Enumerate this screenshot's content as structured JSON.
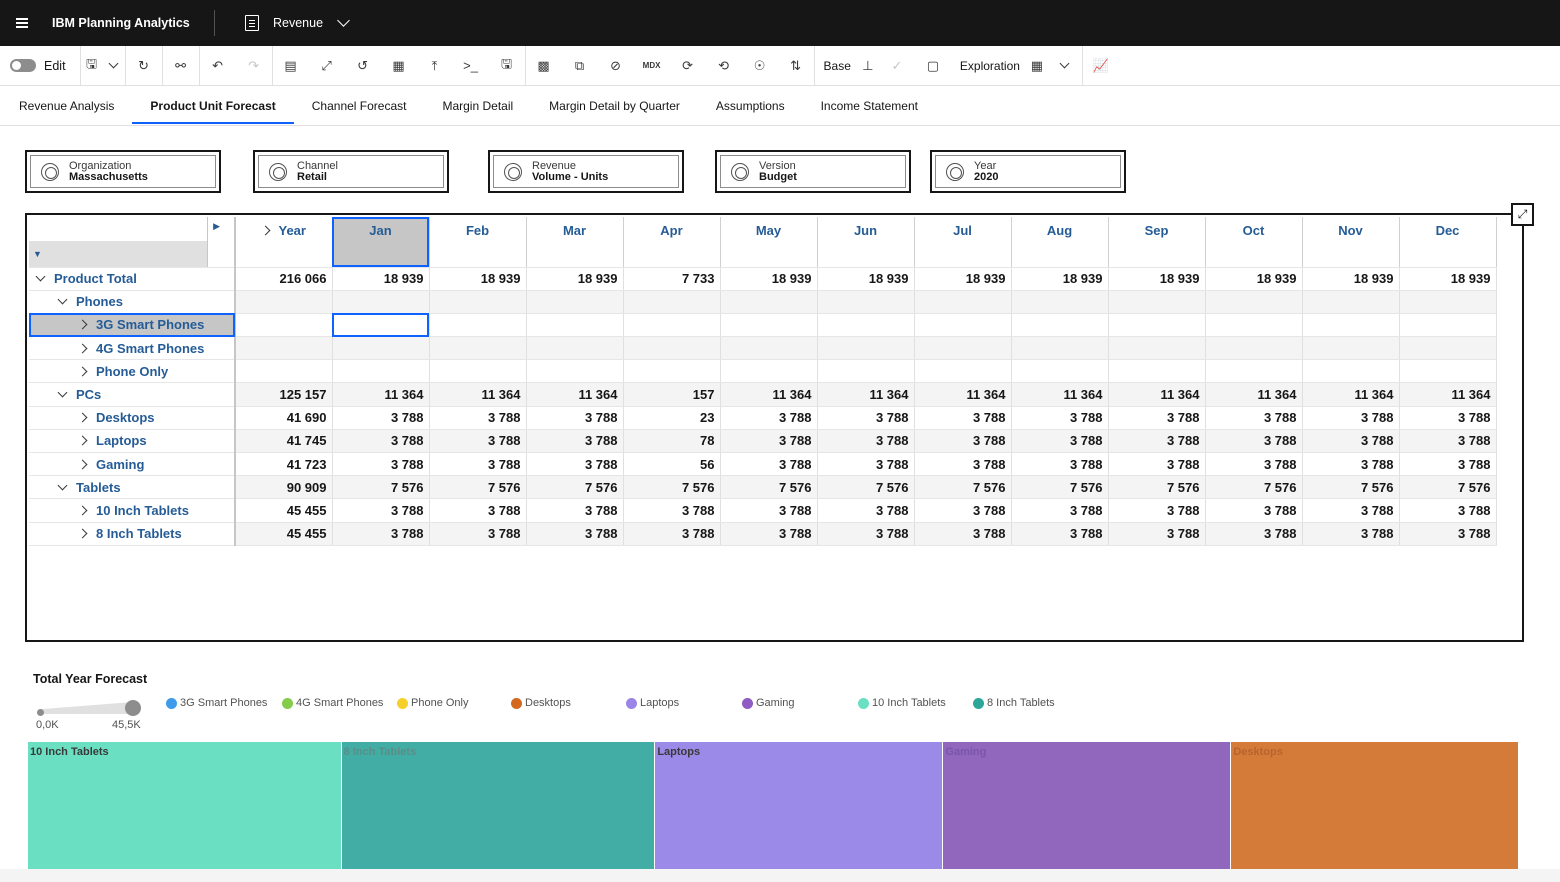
{
  "header": {
    "app_title": "IBM Planning Analytics",
    "book_title": "Revenue"
  },
  "toolbar": {
    "edit_label": "Edit",
    "base_label": "Base",
    "exploration_label": "Exploration",
    "mdx_label": "MDX"
  },
  "tabs": [
    {
      "label": "Revenue Analysis",
      "active": false
    },
    {
      "label": "Product Unit Forecast",
      "active": true
    },
    {
      "label": "Channel Forecast",
      "active": false
    },
    {
      "label": "Margin Detail",
      "active": false
    },
    {
      "label": "Margin Detail by Quarter",
      "active": false
    },
    {
      "label": "Assumptions",
      "active": false
    },
    {
      "label": "Income Statement",
      "active": false
    }
  ],
  "selectors": [
    {
      "dimension": "Organization",
      "member": "Massachusetts"
    },
    {
      "dimension": "Channel",
      "member": "Retail"
    },
    {
      "dimension": "Revenue",
      "member": "Volume - Units"
    },
    {
      "dimension": "Version",
      "member": "Budget"
    },
    {
      "dimension": "Year",
      "member": "2020"
    }
  ],
  "grid": {
    "columns": [
      "Year",
      "Jan",
      "Feb",
      "Mar",
      "Apr",
      "May",
      "Jun",
      "Jul",
      "Aug",
      "Sep",
      "Oct",
      "Nov",
      "Dec"
    ],
    "rows": [
      {
        "label": "Product Total",
        "level": 0,
        "expanded": true,
        "values": [
          "216 066",
          "18 939",
          "18 939",
          "18 939",
          "7 733",
          "18 939",
          "18 939",
          "18 939",
          "18 939",
          "18 939",
          "18 939",
          "18 939",
          "18 939"
        ]
      },
      {
        "label": "Phones",
        "level": 1,
        "expanded": true,
        "values": [
          "",
          "",
          "",
          "",
          "",
          "",
          "",
          "",
          "",
          "",
          "",
          "",
          ""
        ]
      },
      {
        "label": "3G Smart Phones",
        "level": 2,
        "expanded": false,
        "values": [
          "",
          "",
          "",
          "",
          "",
          "",
          "",
          "",
          "",
          "",
          "",
          "",
          ""
        ]
      },
      {
        "label": "4G Smart Phones",
        "level": 2,
        "expanded": false,
        "values": [
          "",
          "",
          "",
          "",
          "",
          "",
          "",
          "",
          "",
          "",
          "",
          "",
          ""
        ]
      },
      {
        "label": "Phone Only",
        "level": 2,
        "expanded": false,
        "values": [
          "",
          "",
          "",
          "",
          "",
          "",
          "",
          "",
          "",
          "",
          "",
          "",
          ""
        ]
      },
      {
        "label": "PCs",
        "level": 1,
        "expanded": true,
        "values": [
          "125 157",
          "11 364",
          "11 364",
          "11 364",
          "157",
          "11 364",
          "11 364",
          "11 364",
          "11 364",
          "11 364",
          "11 364",
          "11 364",
          "11 364"
        ]
      },
      {
        "label": "Desktops",
        "level": 2,
        "expanded": false,
        "values": [
          "41 690",
          "3 788",
          "3 788",
          "3 788",
          "23",
          "3 788",
          "3 788",
          "3 788",
          "3 788",
          "3 788",
          "3 788",
          "3 788",
          "3 788"
        ]
      },
      {
        "label": "Laptops",
        "level": 2,
        "expanded": false,
        "values": [
          "41 745",
          "3 788",
          "3 788",
          "3 788",
          "78",
          "3 788",
          "3 788",
          "3 788",
          "3 788",
          "3 788",
          "3 788",
          "3 788",
          "3 788"
        ]
      },
      {
        "label": "Gaming",
        "level": 2,
        "expanded": false,
        "values": [
          "41 723",
          "3 788",
          "3 788",
          "3 788",
          "56",
          "3 788",
          "3 788",
          "3 788",
          "3 788",
          "3 788",
          "3 788",
          "3 788",
          "3 788"
        ]
      },
      {
        "label": "Tablets",
        "level": 1,
        "expanded": true,
        "values": [
          "90 909",
          "7 576",
          "7 576",
          "7 576",
          "7 576",
          "7 576",
          "7 576",
          "7 576",
          "7 576",
          "7 576",
          "7 576",
          "7 576",
          "7 576"
        ]
      },
      {
        "label": "10 Inch Tablets",
        "level": 2,
        "expanded": false,
        "values": [
          "45 455",
          "3 788",
          "3 788",
          "3 788",
          "3 788",
          "3 788",
          "3 788",
          "3 788",
          "3 788",
          "3 788",
          "3 788",
          "3 788",
          "3 788"
        ]
      },
      {
        "label": "8 Inch Tablets",
        "level": 2,
        "expanded": false,
        "values": [
          "45 455",
          "3 788",
          "3 788",
          "3 788",
          "3 788",
          "3 788",
          "3 788",
          "3 788",
          "3 788",
          "3 788",
          "3 788",
          "3 788",
          "3 788"
        ]
      }
    ]
  },
  "chart": {
    "title": "Total Year Forecast",
    "slider_min": "0,0K",
    "slider_max": "45,5K"
  },
  "chart_data": {
    "type": "treemap",
    "title": "Total Year Forecast",
    "legend": [
      {
        "name": "3G Smart Phones",
        "color": "#3d9be9"
      },
      {
        "name": "4G Smart Phones",
        "color": "#84cc4a"
      },
      {
        "name": "Phone Only",
        "color": "#f5d02a"
      },
      {
        "name": "Desktops",
        "color": "#d2691e"
      },
      {
        "name": "Laptops",
        "color": "#9b85e6"
      },
      {
        "name": "Gaming",
        "color": "#8e5cc3"
      },
      {
        "name": "10 Inch Tablets",
        "color": "#6adfc2"
      },
      {
        "name": "8 Inch Tablets",
        "color": "#2da69a"
      }
    ],
    "tiles": [
      {
        "name": "10 Inch Tablets",
        "value": 45455,
        "color": "#6adfc2"
      },
      {
        "name": "8 Inch Tablets",
        "value": 45455,
        "color": "#41ada5"
      },
      {
        "name": "Laptops",
        "value": 41745,
        "color": "#9b8ae8"
      },
      {
        "name": "Gaming",
        "value": 41723,
        "color": "#9067bc"
      },
      {
        "name": "Desktops",
        "value": 41690,
        "color": "#d47b3a"
      }
    ]
  }
}
